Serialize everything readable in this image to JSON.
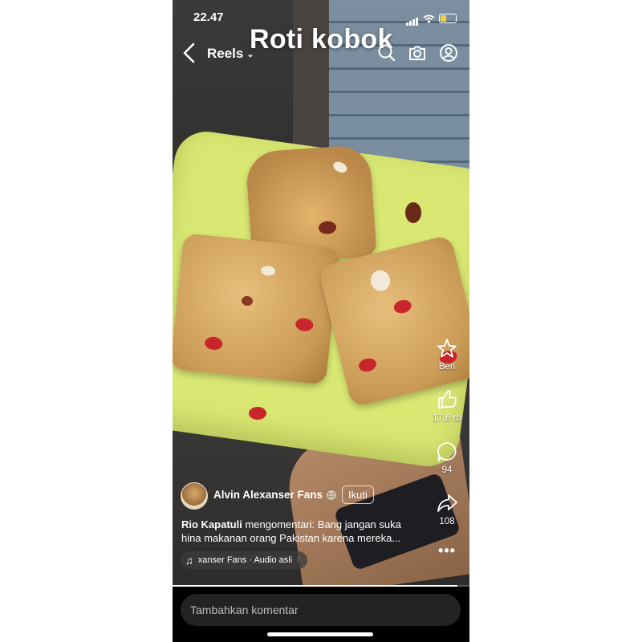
{
  "status_bar": {
    "time": "22.47"
  },
  "header": {
    "title": "Reels",
    "overlay_text": "Roti kobok",
    "icons": [
      "back-icon",
      "search-icon",
      "camera-icon",
      "profile-icon"
    ]
  },
  "side_actions": {
    "gift_label": "Beri",
    "like_count": "17,6 rb",
    "comment_count": "94",
    "share_count": "108"
  },
  "post": {
    "author": "Alvin Alexanser Fans",
    "follow_label": "Ikuti",
    "comment_author": "Rio Kapatuli",
    "comment_text": " mengomentari: Bang jangan suka hina makanan orang Pakistan karena mereka...",
    "audio_label": "xanser Fans · Audio asli"
  },
  "video_progress": 0.96,
  "comment_input": {
    "placeholder": "Tambahkan komentar"
  },
  "colors": {
    "background": "#000000",
    "plate": "#d9e773",
    "battery": "#f4d23c"
  }
}
